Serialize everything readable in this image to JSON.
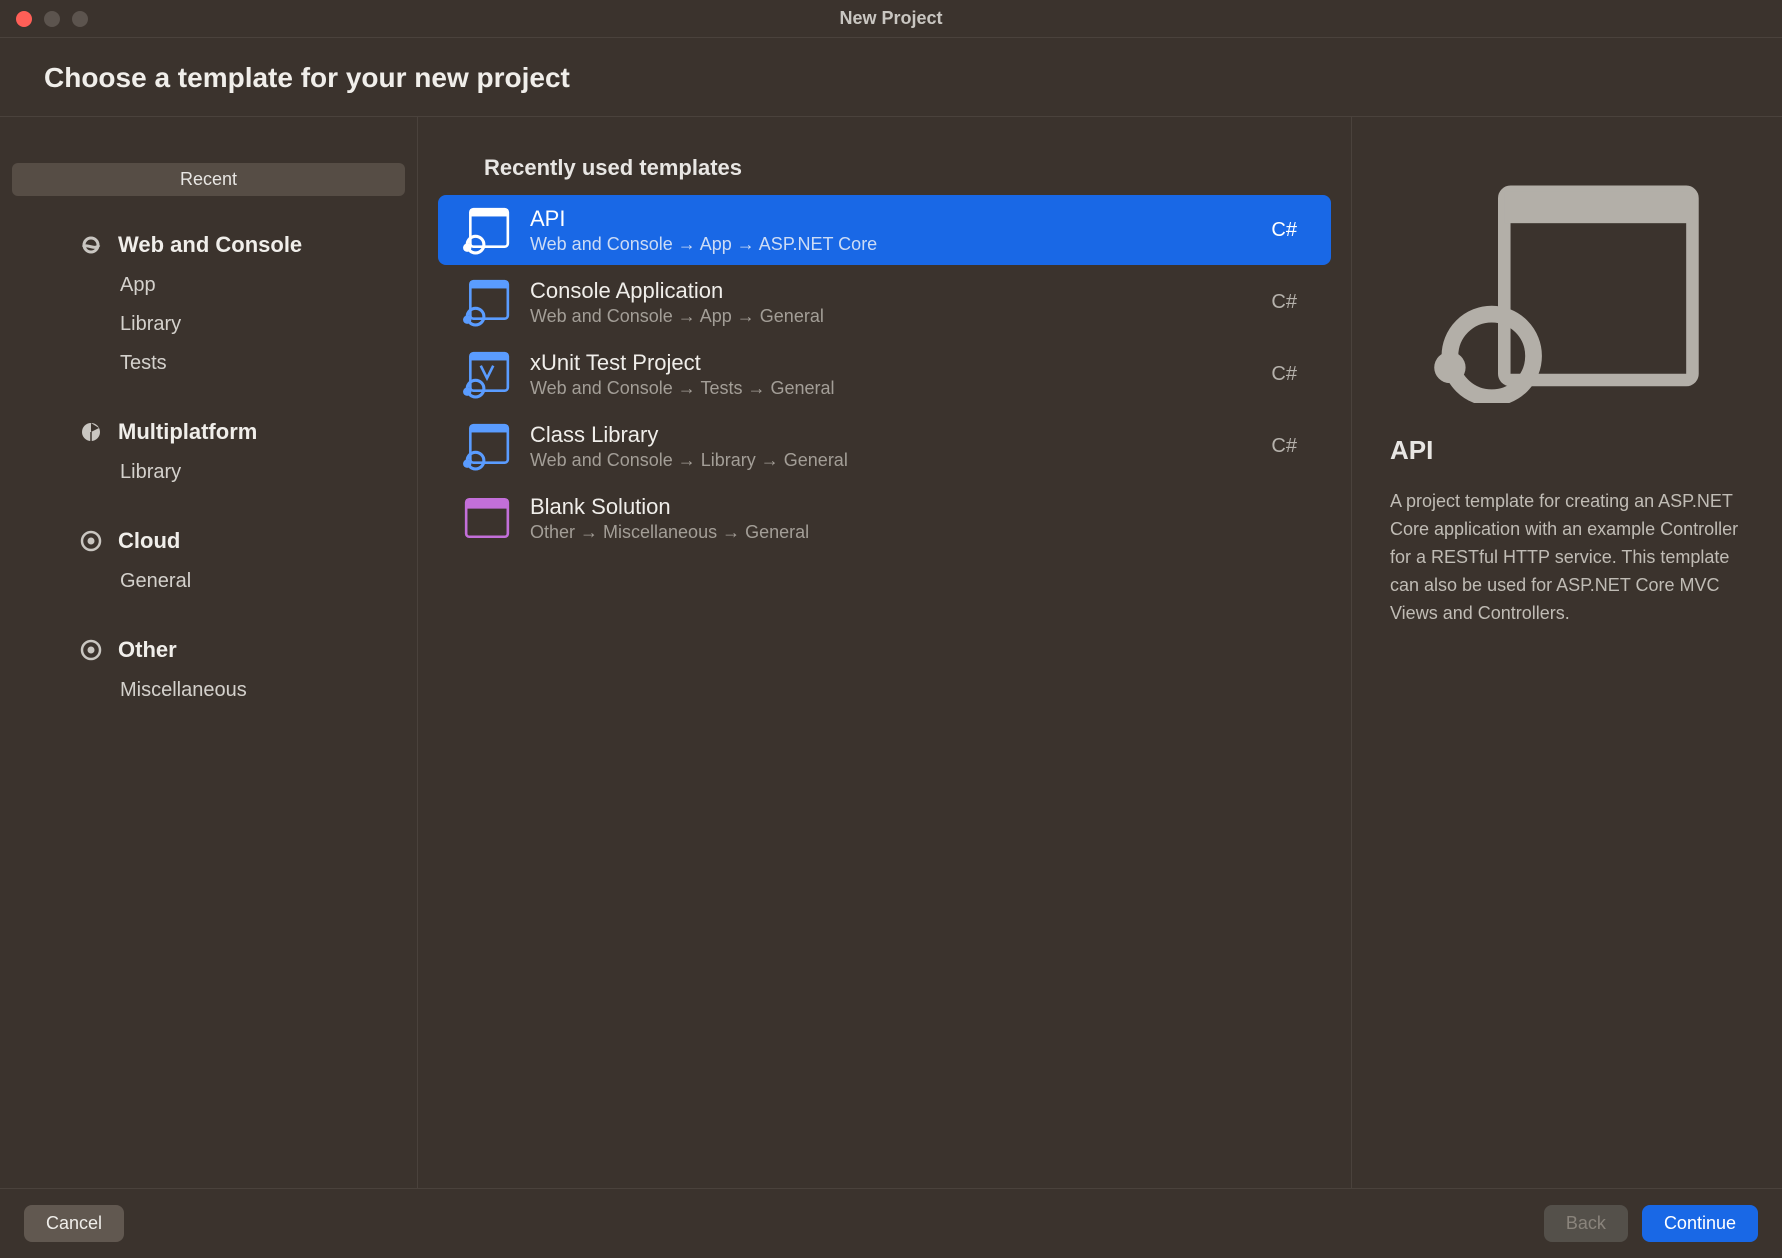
{
  "window": {
    "title": "New Project"
  },
  "header": {
    "title": "Choose a template for your new project"
  },
  "sidebar": {
    "recent_label": "Recent",
    "groups": [
      {
        "label": "Web and Console",
        "items": [
          "App",
          "Library",
          "Tests"
        ]
      },
      {
        "label": "Multiplatform",
        "items": [
          "Library"
        ]
      },
      {
        "label": "Cloud",
        "items": [
          "General"
        ]
      },
      {
        "label": "Other",
        "items": [
          "Miscellaneous"
        ]
      }
    ]
  },
  "main": {
    "heading": "Recently used templates",
    "templates": [
      {
        "title": "API",
        "path": "Web and Console → App → ASP.NET Core",
        "lang": "C#",
        "selected": true,
        "color": "#ffffff"
      },
      {
        "title": "Console Application",
        "path": "Web and Console → App → General",
        "lang": "C#",
        "color": "#5a9cff"
      },
      {
        "title": "xUnit Test Project",
        "path": "Web and Console → Tests → General",
        "lang": "C#",
        "color": "#5a9cff"
      },
      {
        "title": "Class Library",
        "path": "Web and Console → Library → General",
        "lang": "C#",
        "color": "#5a9cff"
      },
      {
        "title": "Blank Solution",
        "path": "Other → Miscellaneous → General",
        "lang": "",
        "color": "#c36fd9"
      }
    ]
  },
  "details": {
    "title": "API",
    "description": "A project template for creating an ASP.NET Core application with an example Controller for a RESTful HTTP service. This template can also be used for ASP.NET Core MVC Views and Controllers."
  },
  "footer": {
    "cancel": "Cancel",
    "back": "Back",
    "continue": "Continue"
  }
}
